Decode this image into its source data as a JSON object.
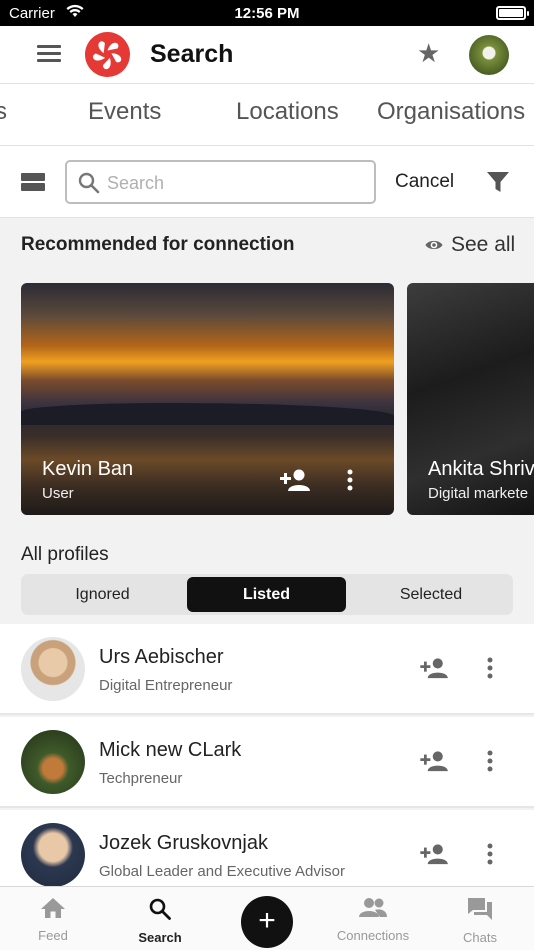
{
  "status": {
    "carrier": "Carrier",
    "time": "12:56 PM"
  },
  "header": {
    "title": "Search"
  },
  "tabs": [
    {
      "label": "s"
    },
    {
      "label": "Events"
    },
    {
      "label": "Locations"
    },
    {
      "label": "Organisations"
    }
  ],
  "search": {
    "placeholder": "Search",
    "value": "",
    "cancel_label": "Cancel"
  },
  "recommended": {
    "title": "Recommended for connection",
    "see_all": "See all",
    "cards": [
      {
        "name": "Kevin Ban",
        "role": "User"
      },
      {
        "name": "Ankita Shriv",
        "role": "Digital markete"
      }
    ]
  },
  "profiles": {
    "title": "All profiles",
    "segments": [
      "Ignored",
      "Listed",
      "Selected"
    ],
    "selected_segment": "Listed",
    "items": [
      {
        "name": "Urs Aebischer",
        "subtitle": "Digital Entrepreneur"
      },
      {
        "name": "Mick new CLark",
        "subtitle": "Techpreneur"
      },
      {
        "name": "Jozek Gruskovnjak",
        "subtitle": "Global Leader and Executive Advisor"
      }
    ]
  },
  "bottom_nav": [
    {
      "label": "Feed",
      "icon": "home-icon"
    },
    {
      "label": "Search",
      "icon": "search-icon"
    },
    {
      "label": "Connections",
      "icon": "people-icon"
    },
    {
      "label": "Chats",
      "icon": "chat-icon"
    }
  ],
  "colors": {
    "brand": "#e53935",
    "active": "#111111",
    "icon": "#555555"
  }
}
